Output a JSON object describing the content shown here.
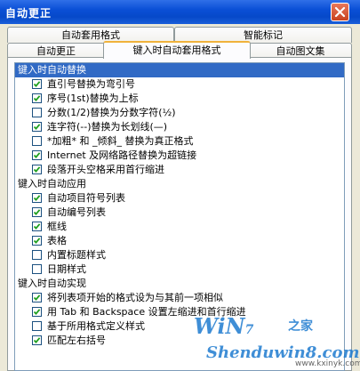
{
  "window": {
    "title": "自动更正"
  },
  "tabs_back": [
    "自动套用格式",
    "智能标记"
  ],
  "tabs_front": [
    "自动更正",
    "键入时自动套用格式",
    "自动图文集"
  ],
  "groups": [
    {
      "label": "键入时自动替换",
      "items": [
        {
          "label": "直引号替换为弯引号",
          "checked": true
        },
        {
          "label": "序号(1st)替换为上标",
          "checked": true
        },
        {
          "label": "分数(1/2)替换为分数字符(½)",
          "checked": false
        },
        {
          "label": "连字符(--)替换为长划线(—)",
          "checked": true
        },
        {
          "label": "*加粗* 和 _倾斜_ 替换为真正格式",
          "checked": false
        },
        {
          "label": "Internet 及网络路径替换为超链接",
          "checked": true
        },
        {
          "label": "段落开头空格采用首行缩进",
          "checked": true
        }
      ]
    },
    {
      "label": "键入时自动应用",
      "items": [
        {
          "label": "自动项目符号列表",
          "checked": true
        },
        {
          "label": "自动编号列表",
          "checked": true
        },
        {
          "label": "框线",
          "checked": true
        },
        {
          "label": "表格",
          "checked": true
        },
        {
          "label": "内置标题样式",
          "checked": false
        },
        {
          "label": "日期样式",
          "checked": false
        }
      ]
    },
    {
      "label": "键入时自动实现",
      "items": [
        {
          "label": "将列表项开始的格式设为与其前一项相似",
          "checked": true
        },
        {
          "label": "用 Tab 和 Backspace 设置左缩进和首行缩进",
          "checked": true
        },
        {
          "label": "基于所用格式定义样式",
          "checked": false
        },
        {
          "label": "匹配左右括号",
          "checked": true
        }
      ]
    }
  ],
  "watermark": {
    "win": "WiN",
    "seven": "7",
    "zhi": "之家",
    "site": "Shenduwin8.com",
    "url": "www.kxinyk.com"
  }
}
